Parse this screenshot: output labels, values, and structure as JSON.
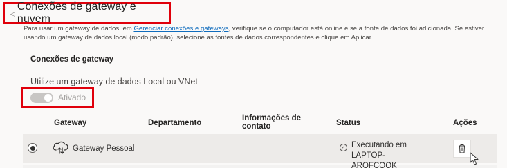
{
  "section": {
    "caret": "◁",
    "title": "Conexões de gateway e nuvem"
  },
  "description": {
    "before_link": "Para usar um gateway de dados, em ",
    "link": "Gerenciar conexões e gateways",
    "after_link": ", verifique se o computador está online e se a fonte de dados foi adicionada. Se estiver usando um gateway de dados local (modo padrão), selecione as fontes de dados correspondentes e clique em Aplicar."
  },
  "gateway_connections": {
    "title": "Conexões de gateway",
    "toggle_label": "Utilize um gateway de dados Local ou VNet",
    "toggle_state": "Ativado"
  },
  "table": {
    "headers": {
      "gateway": "Gateway",
      "department": "Departamento",
      "contact_line1": "Informações de",
      "contact_line2": "contato",
      "status": "Status",
      "actions": "Ações"
    },
    "rows": [
      {
        "gateway": "Gateway Pessoal",
        "status_line1": "Executando em LAPTOP-",
        "status_line2": "AROFCQQK",
        "icon": "cloud-icon",
        "status_icon": "check-circle-icon",
        "action_icon": "trash-icon"
      }
    ]
  },
  "colors": {
    "highlight_border": "#e0000b",
    "link": "#0f6cbd",
    "row_selected": "#edebe9"
  }
}
